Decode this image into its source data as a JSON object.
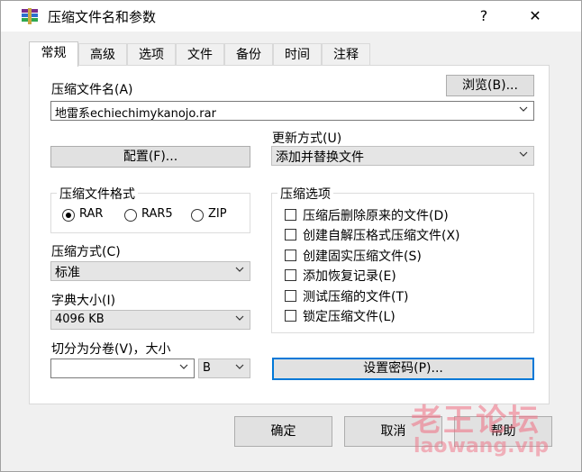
{
  "window": {
    "title": "压缩文件名和参数",
    "help_glyph": "?",
    "close_glyph": "✕"
  },
  "tabs": [
    {
      "label": "常规"
    },
    {
      "label": "高级"
    },
    {
      "label": "选项"
    },
    {
      "label": "文件"
    },
    {
      "label": "备份"
    },
    {
      "label": "时间"
    },
    {
      "label": "注释"
    }
  ],
  "archive_name": {
    "label": "压缩文件名(A)",
    "browse_label": "浏览(B)...",
    "value": "地雷系echiechimykanojo.rar"
  },
  "profiles_label": "配置(F)...",
  "update_mode": {
    "label": "更新方式(U)",
    "value": "添加并替换文件"
  },
  "format": {
    "title": "压缩文件格式",
    "options": [
      {
        "label": "RAR",
        "selected": true
      },
      {
        "label": "RAR5",
        "selected": false
      },
      {
        "label": "ZIP",
        "selected": false
      }
    ]
  },
  "options_group": {
    "title": "压缩选项",
    "items": [
      {
        "label": "压缩后删除原来的文件(D)",
        "checked": false
      },
      {
        "label": "创建自解压格式压缩文件(X)",
        "checked": false
      },
      {
        "label": "创建固实压缩文件(S)",
        "checked": false
      },
      {
        "label": "添加恢复记录(E)",
        "checked": false
      },
      {
        "label": "测试压缩的文件(T)",
        "checked": false
      },
      {
        "label": "锁定压缩文件(L)",
        "checked": false
      }
    ]
  },
  "method": {
    "label": "压缩方式(C)",
    "value": "标准"
  },
  "dictionary": {
    "label": "字典大小(I)",
    "value": "4096 KB"
  },
  "split": {
    "label": "切分为分卷(V)，大小",
    "value": "",
    "unit": "B"
  },
  "password_label": "设置密码(P)...",
  "footer": {
    "ok": "确定",
    "cancel": "取消",
    "help": "帮助"
  },
  "watermark": {
    "cn": "老王论坛",
    "en": "laowang.vip"
  }
}
